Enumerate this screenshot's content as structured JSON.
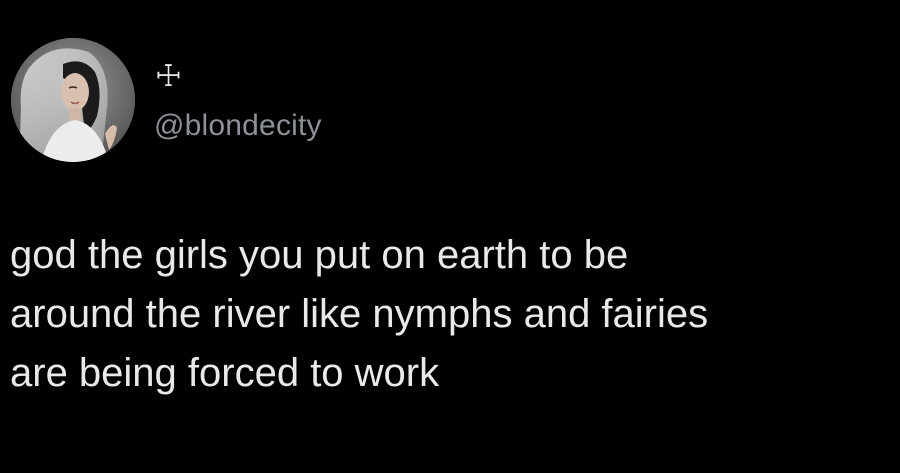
{
  "author": {
    "display_name": "☩",
    "handle": "@blondecity",
    "avatar_icon": "profile-photo-bride-veil"
  },
  "tweet": {
    "lines": [
      "god the girls you put on earth to be",
      "around the river like nymphs and fairies",
      "are being forced to work"
    ]
  },
  "colors": {
    "background": "#000000",
    "text": "#e7e9ea",
    "handle": "#8b9196"
  }
}
